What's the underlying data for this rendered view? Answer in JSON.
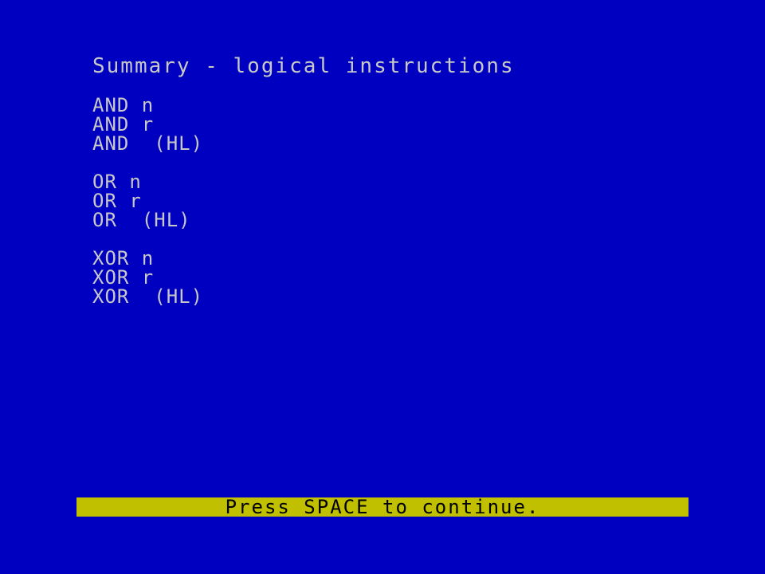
{
  "title": "Summary - logical instructions",
  "groups": [
    {
      "items": [
        "AND n",
        "AND r",
        "AND  (HL)"
      ]
    },
    {
      "items": [
        "OR n",
        "OR r",
        "OR  (HL)"
      ]
    },
    {
      "items": [
        "XOR n",
        "XOR r",
        "XOR  (HL)"
      ]
    }
  ],
  "prompt": "Press SPACE to continue.",
  "colors": {
    "background": "#0000C0",
    "text": "#C8C8C8",
    "prompt_bar": "#C0C000",
    "prompt_text": "#000000"
  }
}
